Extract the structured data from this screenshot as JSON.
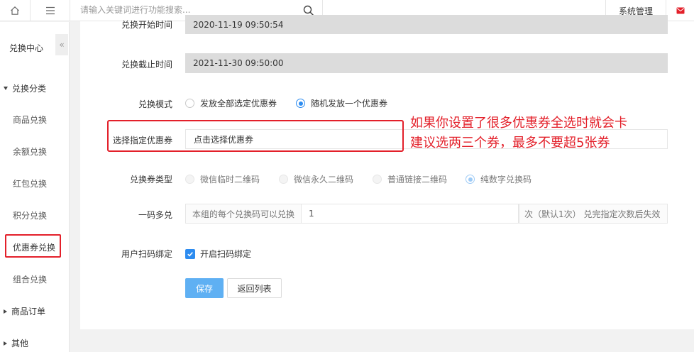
{
  "topbar": {
    "home_icon": "home-icon",
    "menu_icon": "hamburger-menu-icon",
    "search_placeholder": "请输入关键词进行功能搜索...",
    "search_icon": "search-icon",
    "system_label": "系统管理",
    "mail_icon": "mail-icon",
    "mail_color": "#e3202a"
  },
  "sidebar": {
    "title": "兑换中心",
    "collapse_glyph": "«",
    "groups": [
      {
        "label": "兑换分类",
        "expanded": true
      },
      {
        "label": "商品订单",
        "expanded": false
      },
      {
        "label": "其他",
        "expanded": false
      }
    ],
    "items": [
      {
        "label": "商品兑换"
      },
      {
        "label": "余额兑换"
      },
      {
        "label": "红包兑换"
      },
      {
        "label": "积分兑换"
      },
      {
        "label": "优惠券兑换",
        "active": true
      },
      {
        "label": "组合兑换"
      }
    ]
  },
  "form": {
    "start_time": {
      "label": "兑换开始时间",
      "value": "2020-11-19 09:50:54"
    },
    "end_time": {
      "label": "兑换截止时间",
      "value": "2021-11-30 09:50:00"
    },
    "mode": {
      "label": "兑换模式",
      "options": [
        {
          "label": "发放全部选定优惠券",
          "checked": false
        },
        {
          "label": "随机发放一个优惠券",
          "checked": true
        }
      ]
    },
    "coupon": {
      "label": "选择指定优惠券",
      "value": "点击选择优惠券"
    },
    "code_type": {
      "label": "兑换券类型",
      "options": [
        {
          "label": "微信临时二维码",
          "checked": false
        },
        {
          "label": "微信永久二维码",
          "checked": false
        },
        {
          "label": "普通链接二维码",
          "checked": false
        },
        {
          "label": "纯数字兑换码",
          "checked": true
        }
      ]
    },
    "multi": {
      "label": "一码多兑",
      "prefix": "本组的每个兑换码可以兑换",
      "value": "1",
      "suffix": "次（默认1次） 兑完指定次数后失效"
    },
    "bind": {
      "label": "用户扫码绑定",
      "checkbox_label": "开启扫码绑定",
      "checked": true
    },
    "save_label": "保存",
    "back_label": "返回列表"
  },
  "annotation": {
    "line1": "如果你设置了很多优惠券全选时就会卡",
    "line2": "建议选两三个券，最多不要超5张券",
    "color": "#e3202a"
  },
  "colors": {
    "accent": "#2d8cf0",
    "save_button": "#5fb0f3",
    "readonly_bg": "#dcdcdc",
    "highlight_red": "#e3202a"
  }
}
